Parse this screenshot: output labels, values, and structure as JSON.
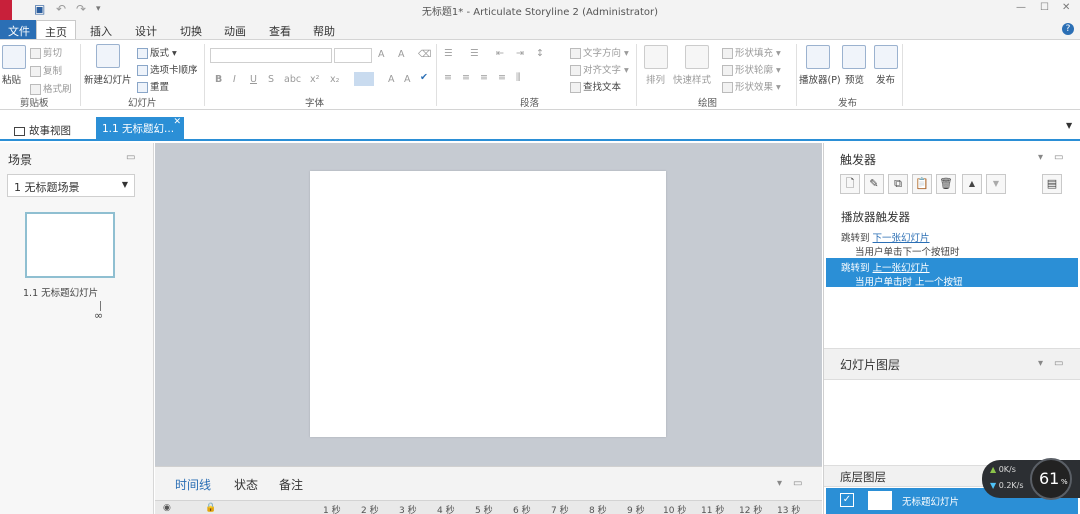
{
  "window": {
    "title": "无标题1* - Articulate Storyline 2 (Administrator)"
  },
  "ribbon_tabs": [
    "文件",
    "主页",
    "插入",
    "设计",
    "切换",
    "动画",
    "查看",
    "帮助"
  ],
  "active_tab": "主页",
  "ribbon": {
    "clipboard": {
      "paste": "粘贴",
      "cut": "剪切",
      "copy": "复制",
      "format_painter": "格式刷",
      "group": "剪贴板"
    },
    "slides": {
      "new_slide": "新建幻灯片",
      "layout": "版式",
      "tab_order": "选项卡顺序",
      "reset": "重置",
      "group": "幻灯片"
    },
    "font": {
      "bold": "B",
      "italic": "I",
      "underline": "U",
      "strike": "S",
      "abc": "abc",
      "group": "字体"
    },
    "paragraph": {
      "text_direction": "文字方向",
      "align_text": "对齐文字",
      "find_text": "查找文本",
      "group": "段落"
    },
    "drawing": {
      "arrange": "排列",
      "quick_styles": "快速样式",
      "shape_fill": "形状填充",
      "shape_outline": "形状轮廓",
      "shape_effects": "形状效果",
      "group": "绘图"
    },
    "publish": {
      "player": "播放器(P)",
      "preview": "预览",
      "publish": "发布",
      "group": "发布"
    }
  },
  "doc_tabs": {
    "story_view": "故事视图",
    "active_slide": "1.1 无标题幻..."
  },
  "scenes_panel": {
    "title": "场景",
    "selected_scene": "1 无标题场景",
    "thumb_label": "1.1 无标题幻灯片"
  },
  "timeline": {
    "tabs": [
      "时间线",
      "状态",
      "备注"
    ],
    "ticks": [
      "1 秒",
      "2 秒",
      "3 秒",
      "4 秒",
      "5 秒",
      "6 秒",
      "7 秒",
      "8 秒",
      "9 秒",
      "10 秒",
      "11 秒",
      "12 秒",
      "13 秒"
    ]
  },
  "triggers_panel": {
    "title": "触发器",
    "section": "播放器触发器",
    "items": [
      {
        "action": "跳转到",
        "target": "下一张幻灯片",
        "when": "当用户单击下一个按钮时",
        "selected": false
      },
      {
        "action": "跳转到",
        "target": "上一张幻灯片",
        "when": "当用户单击时 上一个按钮",
        "selected": true
      }
    ]
  },
  "layers_panel": {
    "title": "幻灯片图层",
    "base_layer_title": "底层图层",
    "base_layer_name": "无标题幻灯片"
  },
  "net_widget": {
    "up": "0K/s",
    "down": "0.2K/s",
    "percent": "61",
    "unit": "%"
  },
  "colors": {
    "accent": "#2b8fd6",
    "file_tab": "#2b6fb5",
    "stage_bg": "#c6cbd2"
  }
}
